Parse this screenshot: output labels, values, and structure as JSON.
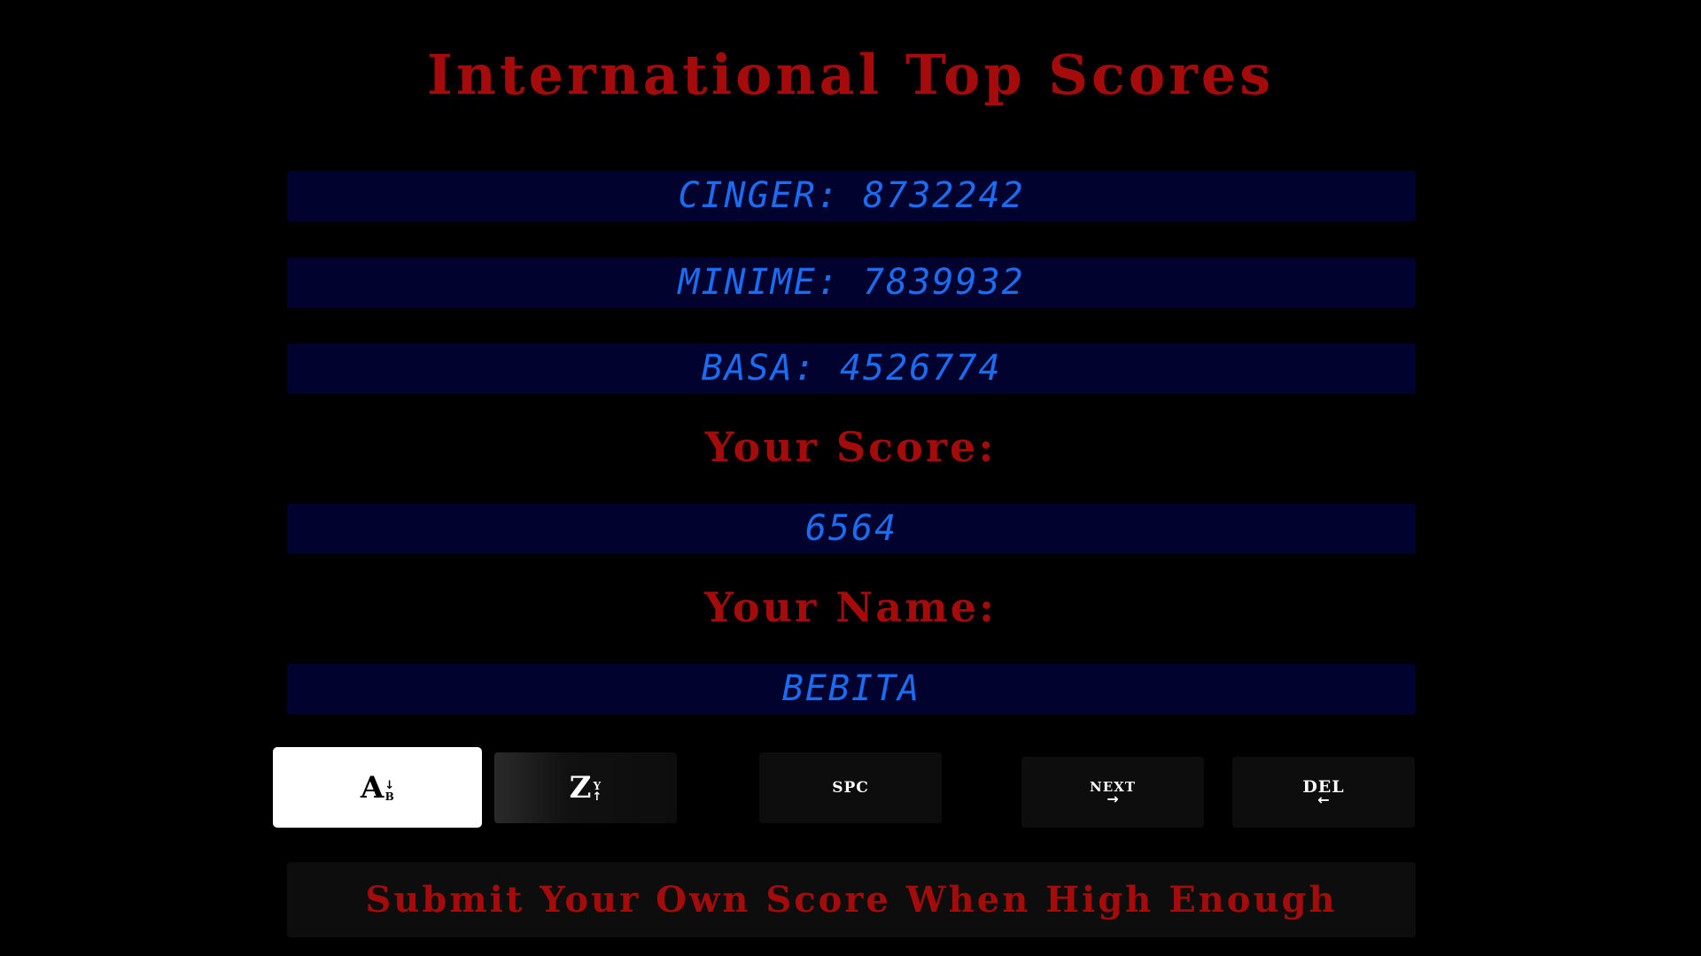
{
  "title": "International Top Scores",
  "top_scores": [
    {
      "text": "CINGER: 8732242"
    },
    {
      "text": "MINIME: 7839932"
    },
    {
      "text": "BASA: 4526774"
    }
  ],
  "your_score": {
    "label": "Your Score:",
    "value": "6564"
  },
  "your_name": {
    "label": "Your Name:",
    "value": "BEBITA"
  },
  "keys": {
    "ab": {
      "big": "A",
      "small": "B",
      "arrow": "↓",
      "selected": true
    },
    "zy": {
      "big": "Z",
      "small": "Y",
      "arrow": "↑"
    },
    "space": {
      "label": "SPC"
    },
    "next": {
      "label": "NEXT",
      "arrow": "→"
    },
    "del": {
      "label": "DEL",
      "arrow": "←"
    }
  },
  "submit": {
    "label": "Submit Your Own Score When High Enough"
  },
  "colors": {
    "background": "#000000",
    "title_red": "#a50b0b",
    "lcd_background": "#02022e",
    "lcd_text": "#1a6cf2",
    "key_background": "#0d0d0d",
    "key_selected": "#ffffff"
  }
}
